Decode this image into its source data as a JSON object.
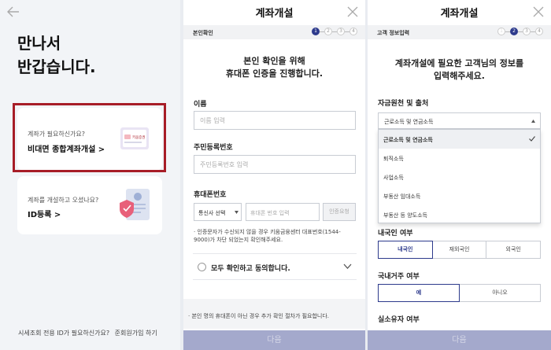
{
  "panel1": {
    "greeting_line1": "만나서",
    "greeting_line2": "반갑습니다.",
    "card1": {
      "small": "계좌가 필요하신가요?",
      "big": "비대면 종합계좌개설 >",
      "icon_text": "키움증권"
    },
    "card2": {
      "small": "계좌를 개설하고 오셨나요?",
      "big": "ID등록 >"
    },
    "footer_question": "시세조회 전용 ID가 필요하신가요?",
    "footer_link": "준회원가입 하기"
  },
  "panel2": {
    "title": "계좌개설",
    "step_label": "본인확인",
    "steps": [
      "1",
      "2",
      "3",
      "4"
    ],
    "active_step": 1,
    "intro_line1": "본인 확인을 위해",
    "intro_line2": "휴대폰 인증을 진행합니다.",
    "name_label": "이름",
    "name_placeholder": "이름 입력",
    "rrn_label": "주민등록번호",
    "rrn_placeholder": "주민등록번호 입력",
    "phone_label": "휴대폰번호",
    "carrier_value": "통신사 선택",
    "phone_placeholder": "휴대폰 번호 입력",
    "verify_button": "인증요청",
    "notice": "· 인증문자가 수신되지 않을 경우 키움금융센터 대표번호(1544-9000)가 차단 되었는지 확인해주세요.",
    "agree_all": "모두 확인하고 동의합니다.",
    "footnote": "· 본인 명의 휴대폰이 아닌 경우 추가 확인 절차가 필요합니다.",
    "next_button": "다음"
  },
  "panel3": {
    "title": "계좌개설",
    "step_label": "고객 정보입력",
    "steps": [
      "1",
      "2",
      "3",
      "4"
    ],
    "active_step": 2,
    "intro_line1": "계좌개설에 필요한 고객님의 정보를",
    "intro_line2": "입력해주세요.",
    "fund_label": "자금원천 및 출처",
    "fund_selected": "근로소득 및 연금소득",
    "fund_options": [
      "근로소득 및 연금소득",
      "퇴직소득",
      "사업소득",
      "부동산 임대소득",
      "부동산 등 양도소득"
    ],
    "residency_label": "내국인 여부",
    "residency_options": [
      "내국인",
      "재외국인",
      "외국인"
    ],
    "residency_selected": 0,
    "domestic_label": "국내거주 여부",
    "domestic_options": [
      "예",
      "아니오"
    ],
    "domestic_selected": 0,
    "owner_label": "실소유자 여부",
    "next_button": "다음"
  },
  "colors": {
    "accent": "#2d3a8c",
    "highlight_box": "#a71d27",
    "disabled_button": "#a4a9cc"
  }
}
